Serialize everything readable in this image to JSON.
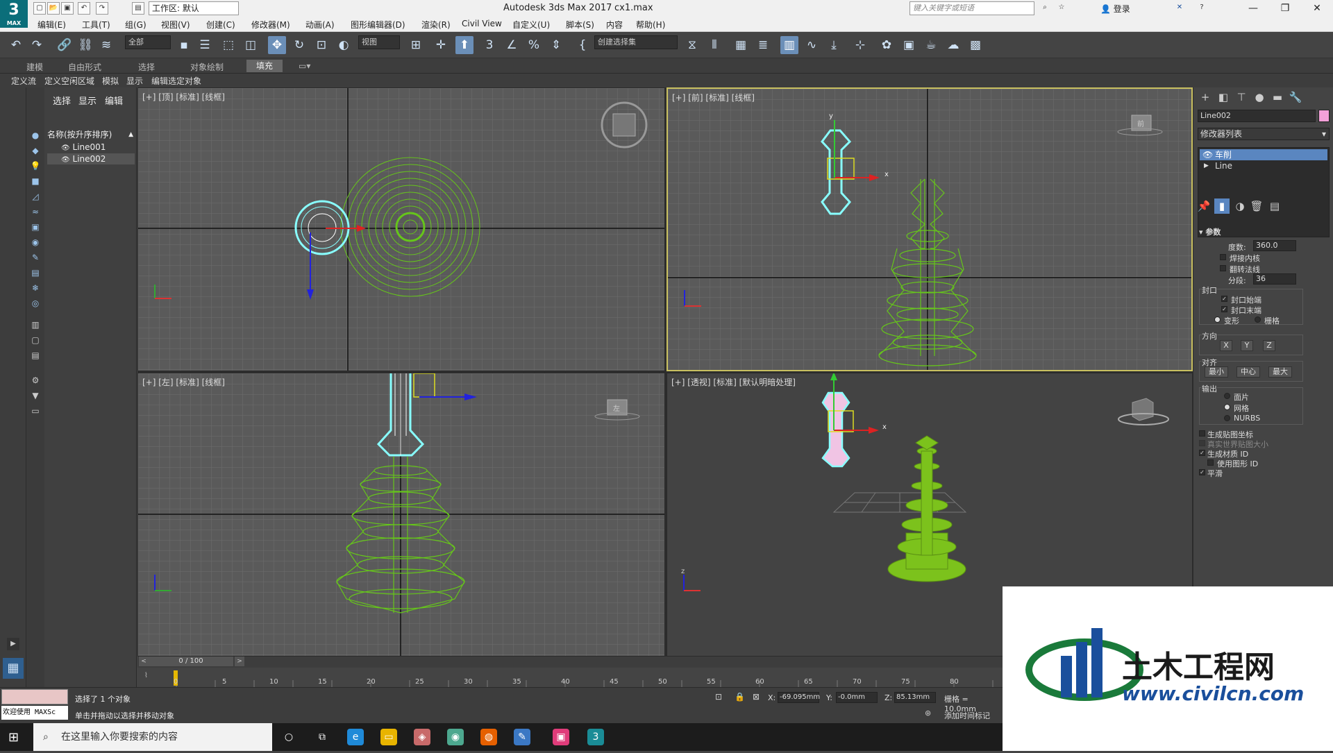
{
  "title_bar": {
    "logo_text": "3",
    "logo_sub": "MAX",
    "workspace": "工作区: 默认",
    "app_title": "Autodesk 3ds Max 2017",
    "file_name": "cx1.max",
    "search_placeholder": "键入关键字或短语",
    "login": "登录",
    "window_controls": [
      "—",
      "❐",
      "✕"
    ]
  },
  "menu": [
    "编辑(E)",
    "工具(T)",
    "组(G)",
    "视图(V)",
    "创建(C)",
    "修改器(M)",
    "动画(A)",
    "图形编辑器(D)",
    "渲染(R)",
    "Civil View",
    "自定义(U)",
    "脚本(S)",
    "内容",
    "帮助(H)"
  ],
  "toolbar": {
    "filter": "全部",
    "ref_coord": "视图",
    "selection_set": "创建选择集"
  },
  "ribbon_tabs": [
    "建模",
    "自由形式",
    "选择",
    "对象绘制",
    "填充"
  ],
  "ribbon_active": "填充",
  "sub_tabs": [
    "定义流",
    "定义空闲区域",
    "模拟",
    "显示",
    "编辑选定对象"
  ],
  "scene_explorer": {
    "tabs": [
      "选择",
      "显示",
      "编辑"
    ],
    "header": "名称(按升序排序)",
    "items": [
      "Line001",
      "Line002"
    ],
    "selected": "Line002"
  },
  "viewports": {
    "top": "[+] [顶] [标准] [线框]",
    "front": "[+] [前] [标准] [线框]",
    "left": "[+] [左] [标准] [线框]",
    "persp": "[+] [透视] [标准] [默认明暗处理]",
    "viewcube_front": "前",
    "viewcube_left": "左",
    "axis_x": "x",
    "axis_y": "y",
    "axis_z": "z"
  },
  "command_panel": {
    "object_name": "Line002",
    "object_color": "#f2a0d8",
    "modifier_list": "修改器列表",
    "stack": [
      "车削",
      "Line"
    ],
    "rollout": "参数",
    "degrees_label": "度数:",
    "degrees": "360.0",
    "weld_core": "焊接内核",
    "flip_normals": "翻转法线",
    "segments_label": "分段:",
    "segments": "36",
    "cap_group": "封口",
    "cap_start": "封口始端",
    "cap_end": "封口末端",
    "morph": "变形",
    "grid": "栅格",
    "direction_group": "方向",
    "dir_x": "X",
    "dir_y": "Y",
    "dir_z": "Z",
    "align_group": "对齐",
    "align_min": "最小",
    "align_center": "中心",
    "align_max": "最大",
    "output_group": "输出",
    "out_patch": "面片",
    "out_mesh": "网格",
    "out_nurbs": "NURBS",
    "gen_map": "生成贴图坐标",
    "real_world": "真实世界贴图大小",
    "gen_matid": "生成材质 ID",
    "use_shape_id": "使用图形 ID",
    "smooth": "平滑"
  },
  "timeline": {
    "frame": "0 / 100",
    "ticks": [
      "0",
      "5",
      "10",
      "15",
      "20",
      "25",
      "30",
      "35",
      "40",
      "45",
      "50",
      "55",
      "60",
      "65",
      "70",
      "75",
      "80"
    ]
  },
  "status": {
    "welcome": "欢迎使用 MAXSc",
    "selected": "选择了 1 个对象",
    "hint": "单击并拖动以选择并移动对象",
    "x_label": "X:",
    "x": "-69.095mm",
    "y_label": "Y:",
    "y": "-0.0mm",
    "z_label": "Z:",
    "z": "85.13mm",
    "grid": "栅格 = 10.0mm",
    "add_key": "添加时间标记"
  },
  "taskbar": {
    "search_placeholder": "在这里输入你要搜索的内容"
  },
  "watermark": {
    "cn": "土木工程网",
    "url": "www.civilcn.com"
  }
}
